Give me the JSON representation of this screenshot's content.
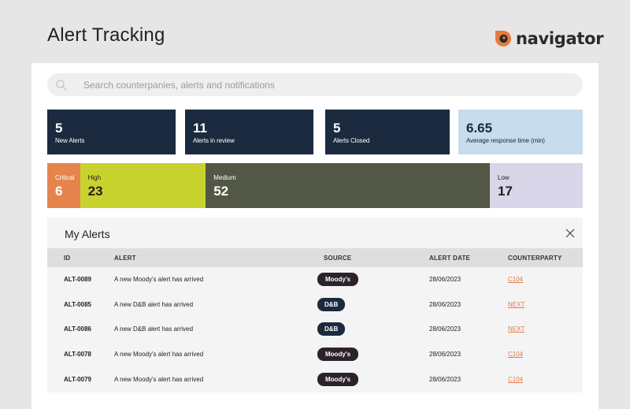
{
  "page": {
    "title": "Alert Tracking"
  },
  "brand": {
    "name": "navigator",
    "accent": "#e8793f"
  },
  "search": {
    "placeholder": "Search counterpanies, alerts and notifications"
  },
  "stats": [
    {
      "value": "5",
      "label": "New Alerts"
    },
    {
      "value": "11",
      "label": "Alerts in review"
    },
    {
      "value": "5",
      "label": "Alerts Closed"
    },
    {
      "value": "6.65",
      "label": "Average response time (min)"
    }
  ],
  "severity": [
    {
      "label": "Critical",
      "value": "6",
      "color": "#e6844e"
    },
    {
      "label": "High",
      "value": "23",
      "color": "#c8d22e"
    },
    {
      "label": "Medium",
      "value": "52",
      "color": "#525845"
    },
    {
      "label": "Low",
      "value": "17",
      "color": "#d8d6e8"
    }
  ],
  "alerts": {
    "title": "My Alerts",
    "columns": [
      "ID",
      "ALERT",
      "SOURCE",
      "ALERT DATE",
      "COUNTERPARTY"
    ],
    "rows": [
      {
        "id": "ALT-0089",
        "alert": "A new Moody's alert has arrived",
        "source": "Moody's",
        "date": "28/06/2023",
        "counterparty": "C104"
      },
      {
        "id": "ALT-0085",
        "alert": "A new D&B alert has arrived",
        "source": "D&B",
        "date": "28/06/2023",
        "counterparty": "NEXT"
      },
      {
        "id": "ALT-0086",
        "alert": "A new D&B alert has arrived",
        "source": "D&B",
        "date": "28/06/2023",
        "counterparty": "NEXT"
      },
      {
        "id": "ALT-0078",
        "alert": "A new Moody's alert has arrived",
        "source": "Moody's",
        "date": "28/06/2023",
        "counterparty": "C104"
      },
      {
        "id": "ALT-0079",
        "alert": "A new Moody's alert has arrived",
        "source": "Moody's",
        "date": "28/06/2023",
        "counterparty": "C104"
      }
    ]
  }
}
